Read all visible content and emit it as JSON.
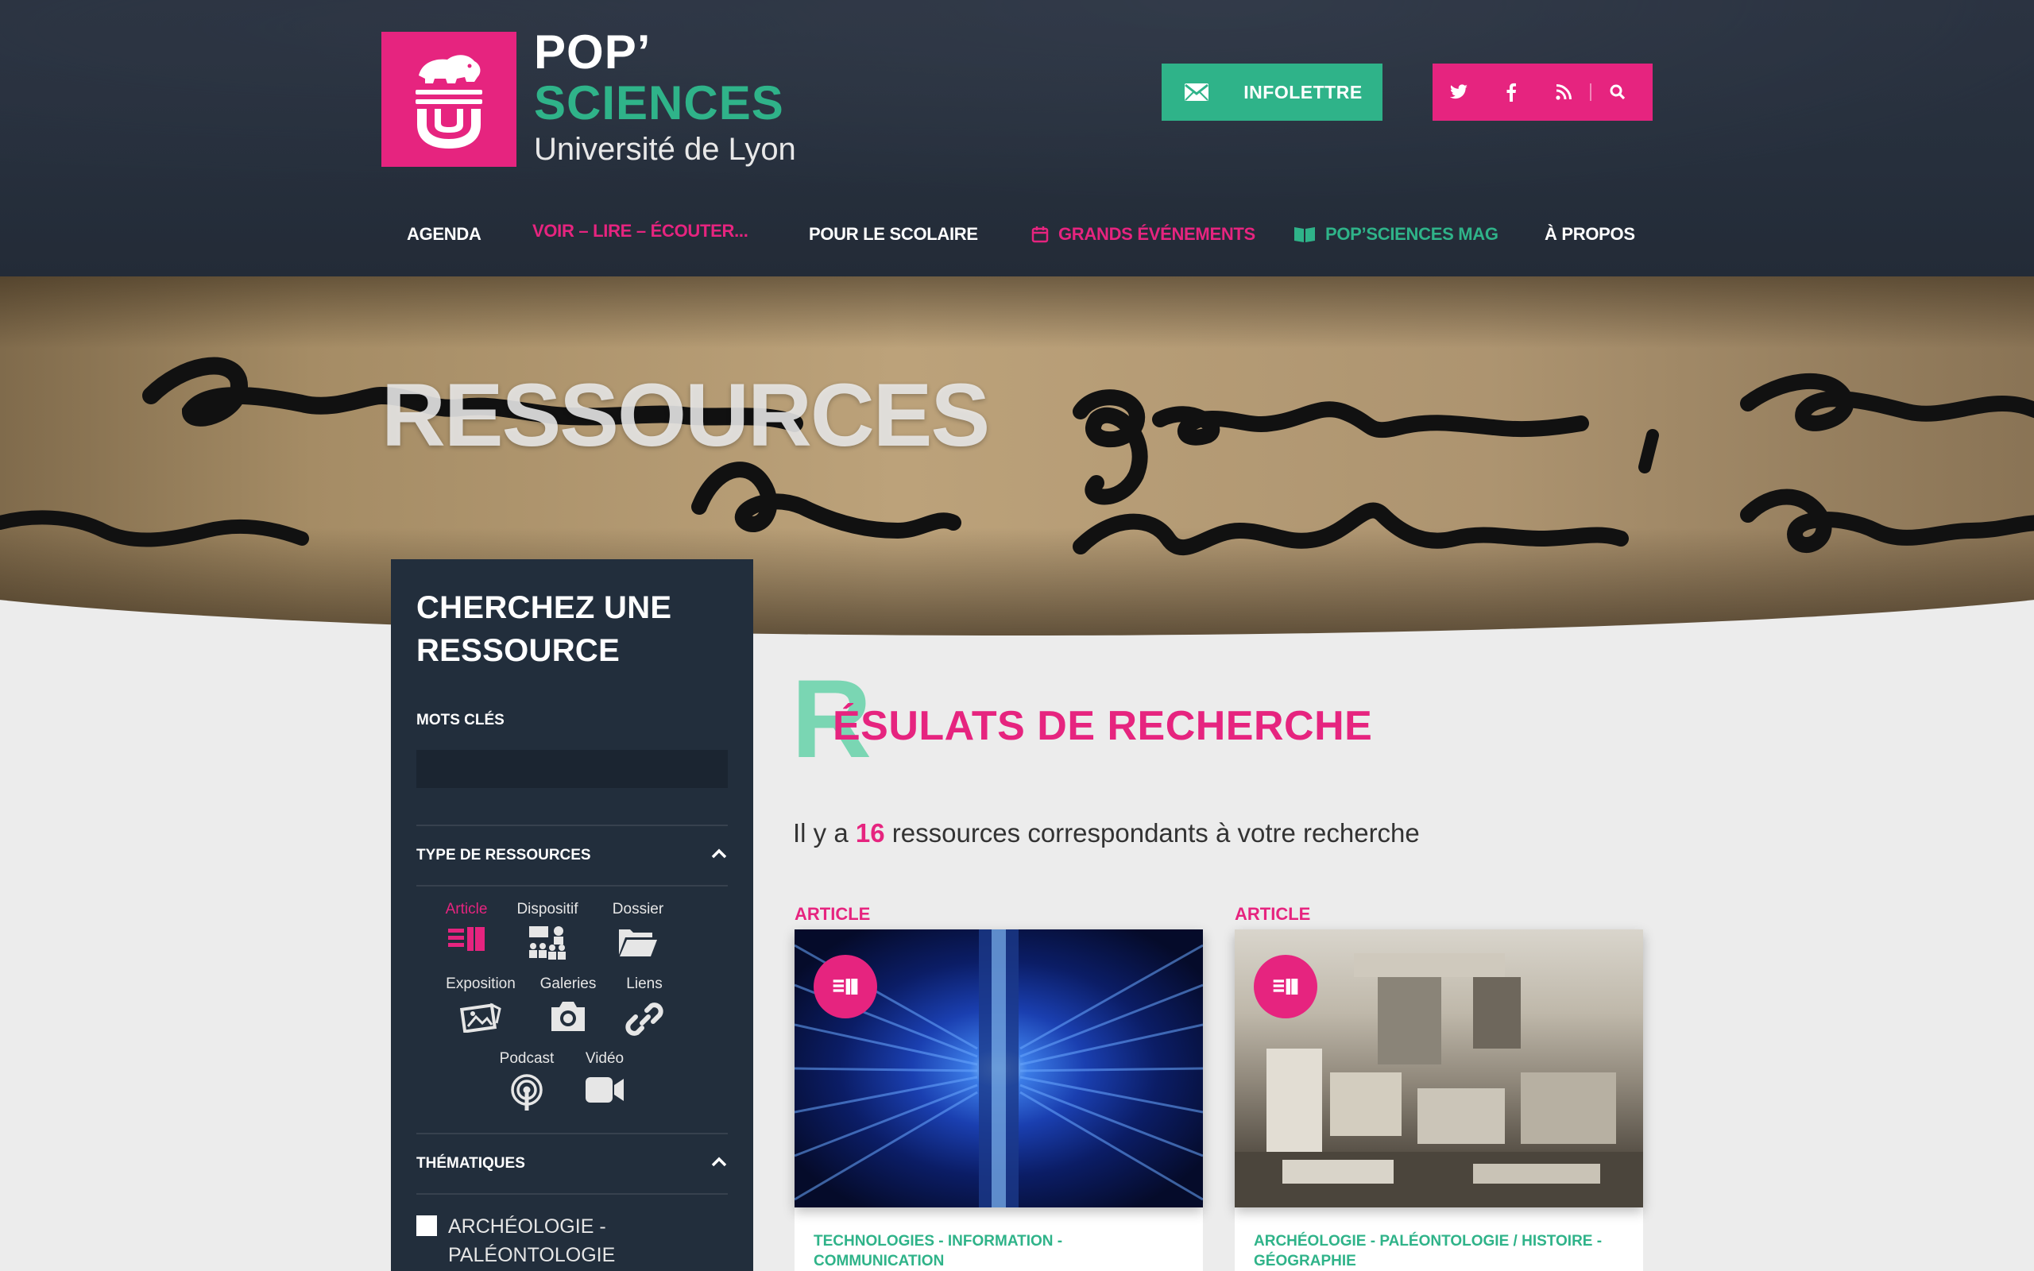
{
  "brand": {
    "line1": "POP’",
    "line2": "SCIENCES",
    "line3": "Université de Lyon",
    "colors": {
      "pink": "#e6247f",
      "green": "#2fb389",
      "navy": "#222e3c"
    }
  },
  "header": {
    "newsletter_label": "INFOLETTRE",
    "social_icons": [
      "twitter-icon",
      "facebook-icon",
      "rss-icon",
      "search-icon"
    ]
  },
  "nav": {
    "agenda": "AGENDA",
    "voir": "VOIR – LIRE – ÉCOUTER...",
    "scolaire": "POUR LE SCOLAIRE",
    "evenements": "GRANDS ÉVÉNEMENTS",
    "mag": "POP’SCIENCES MAG",
    "apropos": "À PROPOS"
  },
  "hero": {
    "title": "RESSOURCES"
  },
  "sidebar": {
    "title": "CHERCHEZ UNE RESSOURCE",
    "keywords_label": "MOTS CLÉS",
    "keywords_value": "",
    "type_section": "TYPE DE RESSOURCES",
    "types": {
      "article": "Article",
      "dispositif": "Dispositif",
      "dossier": "Dossier",
      "exposition": "Exposition",
      "galeries": "Galeries",
      "liens": "Liens",
      "podcast": "Podcast",
      "video": "Vidéo"
    },
    "active_type": "Article",
    "theme_section": "THÉMATIQUES",
    "themes": [
      "ARCHÉOLOGIE - PALÉONTOLOGIE"
    ]
  },
  "results": {
    "big_letter": "R",
    "title": "ÉSULATS DE RECHERCHE",
    "count_prefix": "Il y a",
    "count": "16",
    "count_suffix": "ressources correspondants à votre recherche",
    "cards": [
      {
        "category": "ARTICLE",
        "tag": "TECHNOLOGIES - INFORMATION - COMMUNICATION"
      },
      {
        "category": "ARTICLE",
        "tag": "ARCHÉOLOGIE - PALÉONTOLOGIE / HISTOIRE - GÉOGRAPHIE"
      }
    ]
  }
}
